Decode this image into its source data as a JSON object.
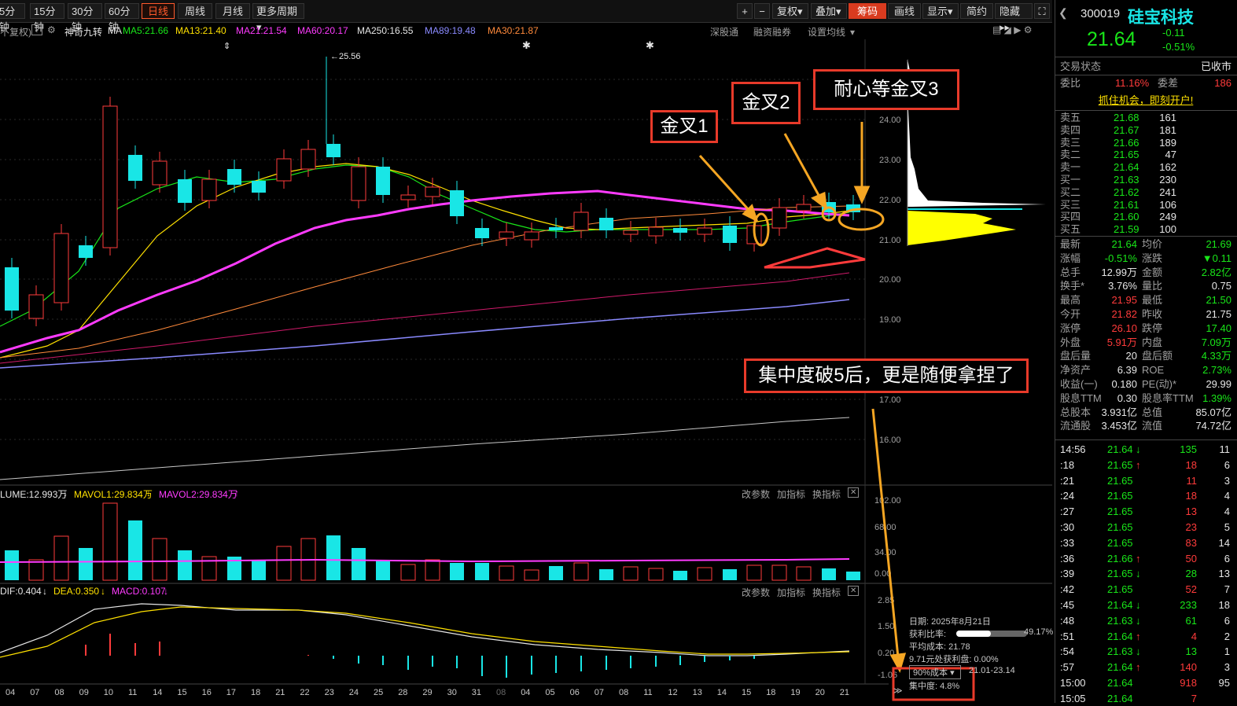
{
  "toolbar": {
    "periods": [
      "5分钟",
      "15分钟",
      "30分钟",
      "60分钟"
    ],
    "active_period": "日线",
    "periods2": [
      "周线",
      "月线"
    ],
    "more_period": "更多周期",
    "plus": "+",
    "minus": "−",
    "fuquan": "复权",
    "diejia": "叠加",
    "chouma": "筹码",
    "huaxian": "画线",
    "xianshi": "显示",
    "jianyue": "简约",
    "yincang": "隐藏"
  },
  "ma_bar": {
    "prefix": "不复权)",
    "help": "?",
    "indicator": "神奇九转",
    "ma_label": "MA",
    "ma5": "MA5:21.66",
    "ma13": "MA13:21.40",
    "ma21": "MA21:21.54",
    "ma60": "MA60:20.17",
    "ma250": "MA250:16.55",
    "ma89": "MA89:19.48",
    "ma30": "MA30:21.87",
    "shendu": "深股通",
    "rongzi": "融资融券",
    "shezhi": "设置均线"
  },
  "annotations": {
    "jincha1": "金叉1",
    "jincha2": "金叉2",
    "jincha3": "耐心等金叉3",
    "concentration_note": "集中度破5后，更是随便拿捏了",
    "peak": "25.56"
  },
  "price_axis": [
    "25.00",
    "24.00",
    "23.00",
    "22.00",
    "21.00",
    "20.00",
    "19.00",
    "17.00",
    "16.00"
  ],
  "vol_bar": {
    "volume": "LUME:12.993万",
    "mavol1": "MAVOL1:29.834万",
    "mavol2": "MAVOL2:29.834万",
    "gaican": "改参数",
    "jiazhibiao": "加指标",
    "huanzhibiao": "换指标"
  },
  "vol_axis": [
    "102.00",
    "68.00",
    "34.00",
    "0.00"
  ],
  "macd_bar": {
    "dif": "DIF:0.404",
    "dea": "DEA:0.350",
    "macd": "MACD:0.107",
    "gaican": "改参数",
    "jiazhibiao": "加指标",
    "huanzhibiao": "换指标"
  },
  "macd_axis": [
    "2.85",
    "1.50",
    "0.20",
    "-1.06"
  ],
  "date_axis": [
    "04",
    "07",
    "08",
    "09",
    "10",
    "11",
    "14",
    "15",
    "16",
    "17",
    "18",
    "21",
    "22",
    "23",
    "24",
    "25",
    "28",
    "29",
    "30",
    "31",
    "08",
    "04",
    "05",
    "06",
    "07",
    "08",
    "11",
    "12",
    "13",
    "14",
    "15",
    "18",
    "19",
    "20",
    "21"
  ],
  "chip_info": {
    "date": "日期: 2025年8月21日",
    "profit_ratio_label": "获利比率:",
    "profit_ratio": "49.17%",
    "avg_cost": "平均成本: 21.78",
    "price_profit": "9.71元处获利盘: 0.00%",
    "cost_select": "90%成本",
    "cost_range": "21.01-23.14",
    "concentration": "集中度: 4.8%"
  },
  "stock": {
    "code": "300019",
    "name": "硅宝科技",
    "price": "21.64",
    "change": "-0.11",
    "pct": "-0.51%",
    "status_label": "交易状态",
    "status": "已收市",
    "weibi_label": "委比",
    "weibi": "11.16%",
    "weicha_label": "委差",
    "weicha": "186",
    "ad": "抓住机会，即刻开户!"
  },
  "orderbook": [
    {
      "label": "卖五",
      "price": "21.68",
      "vol": "161"
    },
    {
      "label": "卖四",
      "price": "21.67",
      "vol": "181"
    },
    {
      "label": "卖三",
      "price": "21.66",
      "vol": "189"
    },
    {
      "label": "卖二",
      "price": "21.65",
      "vol": "47"
    },
    {
      "label": "卖一",
      "price": "21.64",
      "vol": "162"
    },
    {
      "label": "买一",
      "price": "21.63",
      "vol": "230"
    },
    {
      "label": "买二",
      "price": "21.62",
      "vol": "241"
    },
    {
      "label": "买三",
      "price": "21.61",
      "vol": "106"
    },
    {
      "label": "买四",
      "price": "21.60",
      "vol": "249"
    },
    {
      "label": "买五",
      "price": "21.59",
      "vol": "100"
    }
  ],
  "stats": [
    {
      "l1": "最新",
      "v1": "21.64",
      "l2": "均价",
      "v2": "21.69"
    },
    {
      "l1": "涨幅",
      "v1": "-0.51%",
      "l2": "涨跌",
      "v2": "▼0.11"
    },
    {
      "l1": "总手",
      "v1": "12.99万",
      "l2": "金额",
      "v2": "2.82亿"
    },
    {
      "l1": "换手*",
      "v1": "3.76%",
      "l2": "量比",
      "v2": "0.75"
    },
    {
      "l1": "最高",
      "v1": "21.95",
      "l2": "最低",
      "v2": "21.50"
    },
    {
      "l1": "今开",
      "v1": "21.82",
      "l2": "昨收",
      "v2": "21.75"
    },
    {
      "l1": "涨停",
      "v1": "26.10",
      "l2": "跌停",
      "v2": "17.40"
    },
    {
      "l1": "外盘",
      "v1": "5.91万",
      "l2": "内盘",
      "v2": "7.09万"
    },
    {
      "l1": "盘后量",
      "v1": "20",
      "l2": "盘后额",
      "v2": "4.33万"
    },
    {
      "l1": "净资产",
      "v1": "6.39",
      "l2": "ROE",
      "v2": "2.73%"
    },
    {
      "l1": "收益(一)",
      "v1": "0.180",
      "l2": "PE(动)*",
      "v2": "29.99"
    },
    {
      "l1": "股息TTM",
      "v1": "0.30",
      "l2": "股息率TTM",
      "v2": "1.39%"
    },
    {
      "l1": "总股本",
      "v1": "3.931亿",
      "l2": "总值",
      "v2": "85.07亿"
    },
    {
      "l1": "流通股",
      "v1": "3.453亿",
      "l2": "流值",
      "v2": "74.72亿"
    }
  ],
  "ticks": [
    {
      "t": "14:56",
      "p": "21.64",
      "a": "↓",
      "v": "135",
      "n": "11"
    },
    {
      "t": ":18",
      "p": "21.65",
      "a": "↑",
      "v": "18",
      "n": "6"
    },
    {
      "t": ":21",
      "p": "21.65",
      "a": "",
      "v": "11",
      "n": "3"
    },
    {
      "t": ":24",
      "p": "21.65",
      "a": "",
      "v": "18",
      "n": "4"
    },
    {
      "t": ":27",
      "p": "21.65",
      "a": "",
      "v": "13",
      "n": "4"
    },
    {
      "t": ":30",
      "p": "21.65",
      "a": "",
      "v": "23",
      "n": "5"
    },
    {
      "t": ":33",
      "p": "21.65",
      "a": "",
      "v": "83",
      "n": "14"
    },
    {
      "t": ":36",
      "p": "21.66",
      "a": "↑",
      "v": "50",
      "n": "6"
    },
    {
      "t": ":39",
      "p": "21.65",
      "a": "↓",
      "v": "28",
      "n": "13"
    },
    {
      "t": ":42",
      "p": "21.65",
      "a": "",
      "v": "52",
      "n": "7"
    },
    {
      "t": ":45",
      "p": "21.64",
      "a": "↓",
      "v": "233",
      "n": "18"
    },
    {
      "t": ":48",
      "p": "21.63",
      "a": "↓",
      "v": "61",
      "n": "6"
    },
    {
      "t": ":51",
      "p": "21.64",
      "a": "↑",
      "v": "4",
      "n": "2"
    },
    {
      "t": ":54",
      "p": "21.63",
      "a": "↓",
      "v": "13",
      "n": "1"
    },
    {
      "t": ":57",
      "p": "21.64",
      "a": "↑",
      "v": "140",
      "n": "3"
    },
    {
      "t": "15:00",
      "p": "21.64",
      "a": "",
      "v": "918",
      "n": "95"
    },
    {
      "t": "15:05",
      "p": "21.64",
      "a": "",
      "v": "7",
      "n": ""
    }
  ],
  "colors": {
    "up": "#ff3b3b",
    "down": "#19e6e6",
    "accent": "#ff5a2c"
  }
}
